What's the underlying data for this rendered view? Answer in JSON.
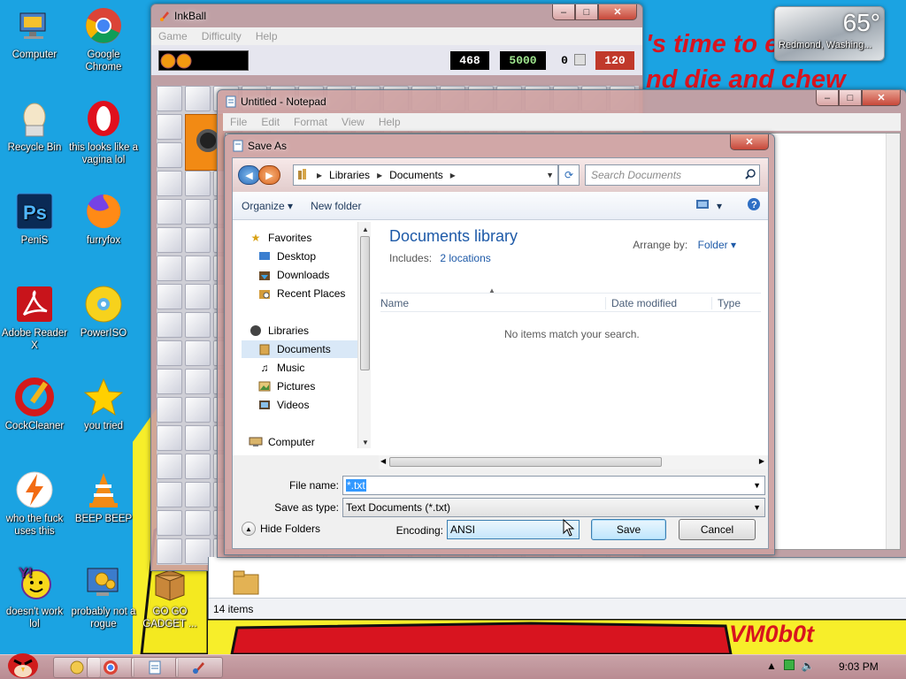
{
  "desktop": {
    "wallpaper_text_1": "'s time to e",
    "wallpaper_text_2": "nd die and chew",
    "wallpaper_signature": "VM0b0t",
    "icons": [
      {
        "label": "Computer"
      },
      {
        "label": "Google Chrome"
      },
      {
        "label": "Recycle Bin"
      },
      {
        "label": "this looks like a vagina lol"
      },
      {
        "label": "PeniS"
      },
      {
        "label": "furryfox"
      },
      {
        "label": "Adobe Reader X"
      },
      {
        "label": "PowerISO"
      },
      {
        "label": "CockCleaner"
      },
      {
        "label": "you tried"
      },
      {
        "label": "who the fuck uses this"
      },
      {
        "label": "BEEP BEEP"
      },
      {
        "label": "doesn't work lol"
      },
      {
        "label": "probably not a rogue"
      },
      {
        "label": "GO GO GADGET ..."
      }
    ]
  },
  "inkball": {
    "title": "InkBall",
    "menu": [
      "Game",
      "Difficulty",
      "Help"
    ],
    "scores": {
      "time": "468",
      "score": "5000",
      "balls": "0",
      "count": "120"
    }
  },
  "notepad": {
    "title": "Untitled - Notepad",
    "menu": [
      "File",
      "Edit",
      "Format",
      "View",
      "Help"
    ]
  },
  "explorer": {
    "status": "14 items"
  },
  "save_as": {
    "title": "Save As",
    "breadcrumb": [
      "Libraries",
      "Documents"
    ],
    "search_placeholder": "Search Documents",
    "toolbar": {
      "organize": "Organize",
      "new_folder": "New folder"
    },
    "nav": {
      "favorites": "Favorites",
      "desktop": "Desktop",
      "downloads": "Downloads",
      "recent": "Recent Places",
      "libraries": "Libraries",
      "documents": "Documents",
      "music": "Music",
      "pictures": "Pictures",
      "videos": "Videos",
      "computer": "Computer"
    },
    "library_title": "Documents library",
    "includes_label": "Includes:",
    "includes_link": "2 locations",
    "arrange_label": "Arrange by:",
    "arrange_value": "Folder",
    "columns": {
      "name": "Name",
      "date": "Date modified",
      "type": "Type"
    },
    "empty_message": "No items match your search.",
    "file_name_label": "File name:",
    "file_name_value": "*.txt",
    "save_type_label": "Save as type:",
    "save_type_value": "Text Documents (*.txt)",
    "hide_folders": "Hide Folders",
    "encoding_label": "Encoding:",
    "encoding_value": "ANSI",
    "save_button": "Save",
    "cancel_button": "Cancel"
  },
  "weather": {
    "temp": "65°",
    "city": "Redmond, Washing..."
  },
  "taskbar": {
    "clock": "9:03 PM"
  }
}
